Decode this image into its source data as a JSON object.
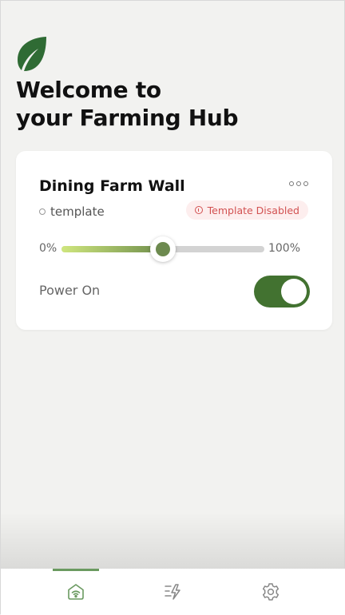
{
  "header": {
    "title_line1": "Welcome to",
    "title_line2": "your Farming Hub"
  },
  "device_card": {
    "name": "Dining Farm Wall",
    "template_label": "template",
    "status_badge": "Template Disabled",
    "slider": {
      "min_label": "0%",
      "max_label": "100%",
      "value_percent": 50
    },
    "power_label": "Power On",
    "power_on": true
  },
  "tabs": [
    {
      "icon": "home-wifi-icon",
      "active": true
    },
    {
      "icon": "automation-icon",
      "active": false
    },
    {
      "icon": "gear-icon",
      "active": false
    }
  ],
  "colors": {
    "brand_green": "#427230",
    "leaf_green": "#2f6b34",
    "slider_thumb": "#6d8a4f",
    "badge_text": "#d25151",
    "badge_bg": "#fdeeee"
  }
}
